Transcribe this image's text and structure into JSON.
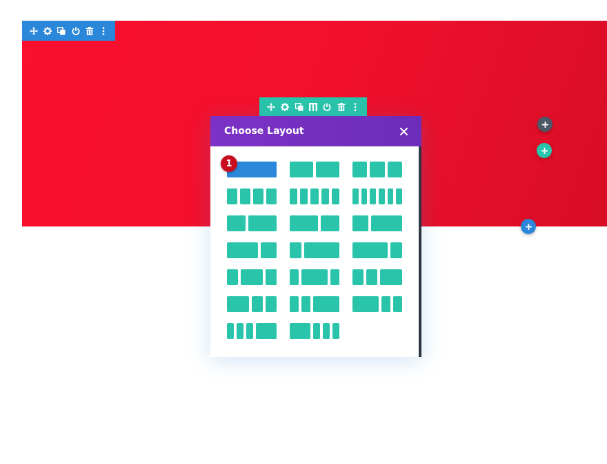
{
  "modal": {
    "title": "Choose Layout",
    "close_icon": "close-icon"
  },
  "badge": {
    "number": "1"
  },
  "colors": {
    "section_bg": "#f1102c",
    "section_toolbar": "#2b87da",
    "row_toolbar": "#29c4a9",
    "modal_header": "#7b2fc4",
    "layout_column": "#29c4a9",
    "selected_layout": "#2b87da"
  },
  "section_toolbar": {
    "icons": [
      "move-icon",
      "settings-icon",
      "duplicate-icon",
      "toggle-power-icon",
      "delete-icon",
      "more-options-icon"
    ]
  },
  "row_toolbar": {
    "icons": [
      "move-icon",
      "settings-icon",
      "duplicate-icon",
      "columns-layout-icon",
      "toggle-power-icon",
      "delete-icon",
      "more-options-icon"
    ]
  },
  "add_buttons": [
    "add-module-button",
    "add-row-button",
    "add-section-button"
  ],
  "layouts": [
    {
      "name": "one-column",
      "columns": [
        1
      ],
      "selected": true
    },
    {
      "name": "two-columns",
      "columns": [
        1,
        1
      ]
    },
    {
      "name": "three-columns",
      "columns": [
        1,
        1,
        1
      ]
    },
    {
      "name": "four-columns",
      "columns": [
        1,
        1,
        1,
        1
      ]
    },
    {
      "name": "five-columns",
      "columns": [
        1,
        1,
        1,
        1,
        1
      ]
    },
    {
      "name": "six-columns",
      "columns": [
        1,
        1,
        1,
        1,
        1,
        1
      ]
    },
    {
      "name": "two-fifths-three-fifths",
      "columns": [
        2,
        3
      ]
    },
    {
      "name": "three-fifths-two-fifths",
      "columns": [
        3,
        2
      ]
    },
    {
      "name": "one-third-two-thirds",
      "columns": [
        1,
        2
      ]
    },
    {
      "name": "two-thirds-one-third",
      "columns": [
        2,
        1
      ]
    },
    {
      "name": "one-quarter-three-quarters",
      "columns": [
        1,
        3
      ]
    },
    {
      "name": "three-quarters-one-quarter",
      "columns": [
        3,
        1
      ]
    },
    {
      "name": "quarter-half-quarter",
      "columns": [
        1,
        2,
        1
      ]
    },
    {
      "name": "fifth-three-fifths-fifth",
      "columns": [
        1,
        3,
        1
      ]
    },
    {
      "name": "quarter-quarter-half",
      "columns": [
        1,
        1,
        2
      ]
    },
    {
      "name": "half-quarter-quarter",
      "columns": [
        2,
        1,
        1
      ]
    },
    {
      "name": "quarter-quarter-half-alt",
      "columns": [
        1,
        1,
        3
      ]
    },
    {
      "name": "half-quarter-quarter-alt",
      "columns": [
        3,
        1,
        1
      ]
    },
    {
      "name": "sixth-sixth-sixth-half",
      "columns": [
        1,
        1,
        1,
        3
      ]
    },
    {
      "name": "half-sixth-sixth-sixth",
      "columns": [
        3,
        1,
        1,
        1
      ]
    }
  ]
}
